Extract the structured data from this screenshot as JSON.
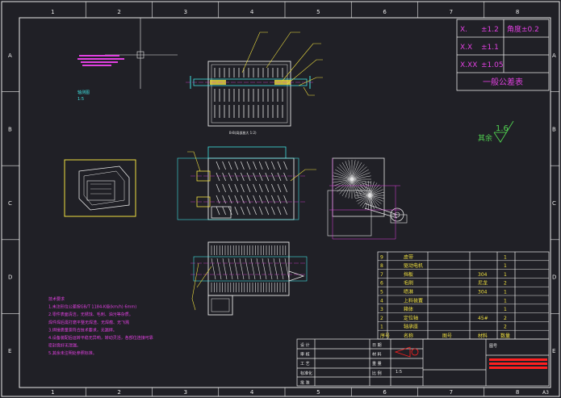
{
  "border": {
    "cols": [
      "1",
      "2",
      "3",
      "4",
      "5",
      "6",
      "7",
      "8"
    ],
    "rows": [
      "A",
      "B",
      "C",
      "D",
      "E"
    ],
    "sheet_code": "A3"
  },
  "tolerance": {
    "rows": [
      {
        "k": "X.",
        "v": "±1.2"
      },
      {
        "k": "X.X",
        "v": "±1.1"
      },
      {
        "k": "X.XX",
        "v": "±1.05"
      }
    ],
    "angle": "角度±0.2",
    "title": "一般公差表"
  },
  "roughness": {
    "label": "其余",
    "value": "1.6"
  },
  "bom": {
    "rows": [
      {
        "no": "9",
        "name": "皮带",
        "mat": "",
        "qty": "1"
      },
      {
        "no": "8",
        "name": "驱动电机",
        "mat": "",
        "qty": "1"
      },
      {
        "no": "7",
        "name": "挡板",
        "mat": "304",
        "qty": "1"
      },
      {
        "no": "6",
        "name": "毛刷",
        "mat": "尼龙",
        "qty": "2"
      },
      {
        "no": "5",
        "name": "喷淋",
        "mat": "304",
        "qty": "1"
      },
      {
        "no": "4",
        "name": "上料装置",
        "mat": "",
        "qty": "1"
      },
      {
        "no": "3",
        "name": "箱体",
        "mat": "",
        "qty": "1"
      },
      {
        "no": "2",
        "name": "定位轴",
        "mat": "45#",
        "qty": "2"
      },
      {
        "no": "1",
        "name": "轴承座",
        "mat": "",
        "qty": "2"
      }
    ],
    "header": {
      "no": "序号",
      "name": "名称",
      "code": "图号",
      "mat": "材料",
      "qty": "数量"
    }
  },
  "notes": {
    "lines": [
      "技术要求",
      "1.未注形位公差按GB/T 1184-K级(km/h) 6mm)",
      "2.零件表面清洁，无锈蚀、毛刺、油污等杂质。",
      "  焊件焊后需打磨平整无焊渣、无焊瘤、无飞溅",
      "3.焊接质量需符合技术要求，无漏焊。",
      "4.设备装配后运转平稳无异响，转动灵活，各部位连接可靠",
      "  密封良好无泄漏。",
      "5.其余未注明处参照标准。"
    ]
  },
  "view_captions": {
    "top_view": "B-B(局部放大 1:2)",
    "iso_label": "轴测图",
    "iso_scale": "1:5"
  },
  "title_block": {
    "labels": [
      "设 计",
      "审 核",
      "工 艺",
      "标准化",
      "批 准"
    ],
    "mid_labels": [
      "日 期",
      "材 料",
      "重 量",
      "比 例"
    ],
    "project": "图号",
    "unit": "1:5"
  },
  "colors": {
    "bg": "#202026",
    "border": "#e8e8e8",
    "cyan": "#40e0e0",
    "yellow": "#f0e040",
    "magenta": "#e040e0",
    "green": "#50d050",
    "red": "#ff2020"
  }
}
